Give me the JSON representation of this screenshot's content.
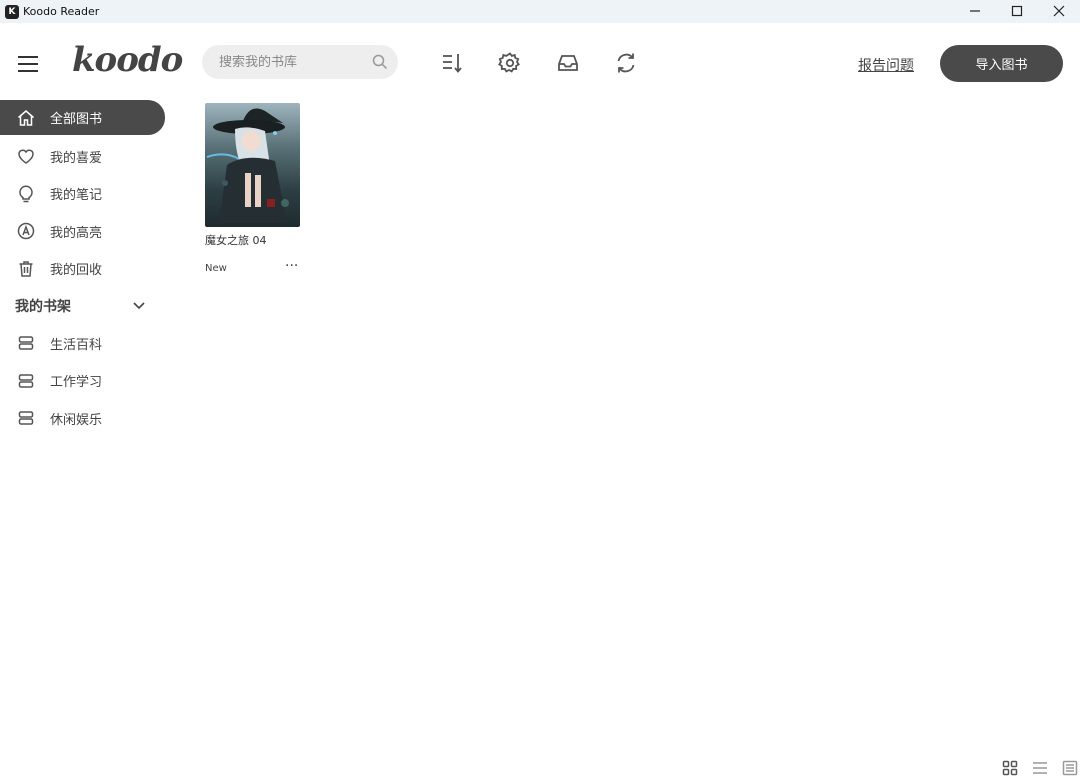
{
  "window": {
    "title": "Koodo Reader",
    "icon_letter": "K",
    "controls": [
      "minimize-icon",
      "maximize-icon",
      "close-icon"
    ]
  },
  "header": {
    "logo": "koodo",
    "search_placeholder": "搜索我的书库",
    "tools": [
      "sort-icon",
      "settings-icon",
      "inbox-icon",
      "sync-icon"
    ],
    "report_link": "报告问题",
    "import_button": "导入图书"
  },
  "sidebar": {
    "items": [
      {
        "label": "全部图书",
        "icon": "home-icon",
        "active": true
      },
      {
        "label": "我的喜爱",
        "icon": "heart-icon",
        "active": false
      },
      {
        "label": "我的笔记",
        "icon": "lightbulb-icon",
        "active": false
      },
      {
        "label": "我的高亮",
        "icon": "highlight-icon",
        "active": false
      },
      {
        "label": "我的回收",
        "icon": "trash-icon",
        "active": false
      }
    ],
    "shelf_header": "我的书架",
    "shelves": [
      {
        "label": "生活百科",
        "icon": "shelf-icon"
      },
      {
        "label": "工作学习",
        "icon": "shelf-icon"
      },
      {
        "label": "休闲娱乐",
        "icon": "shelf-icon"
      }
    ]
  },
  "books": [
    {
      "title": "魔女之旅 04",
      "badge": "New",
      "more": "···"
    }
  ],
  "footer": {
    "view_modes": [
      "grid-view-icon",
      "list-view-icon",
      "detail-view-icon"
    ]
  },
  "colors": {
    "titlebar_bg": "#eef3f7",
    "accent_dark": "#4a4a4a",
    "search_bg": "#eeeeee"
  }
}
